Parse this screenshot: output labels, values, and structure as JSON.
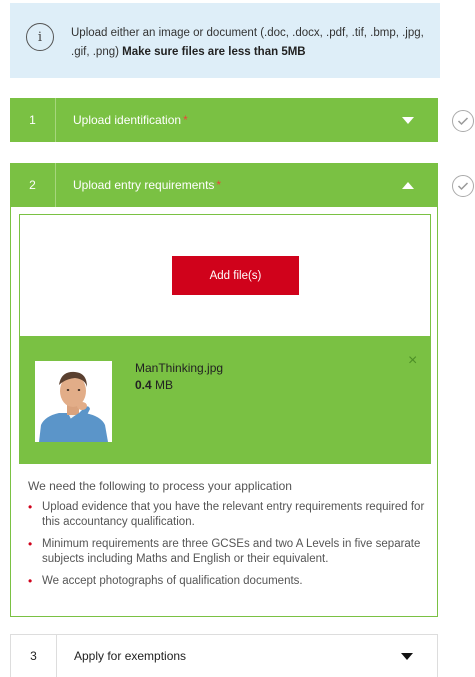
{
  "info": {
    "text": "Upload either an image or document (.doc, .docx, .pdf, .tif, .bmp, .jpg, .gif, .png)",
    "bold_text": "Make sure files are less than 5MB"
  },
  "sections": [
    {
      "number": "1",
      "title": "Upload identification",
      "required": "*",
      "state": "collapsed"
    },
    {
      "number": "2",
      "title": "Upload entry requirements",
      "required": "*",
      "state": "expanded"
    },
    {
      "number": "3",
      "title": "Apply for exemptions",
      "required": "",
      "state": "collapsed"
    }
  ],
  "upload": {
    "add_button_label": "Add file(s)",
    "file": {
      "name": "ManThinking.jpg",
      "size_value": "0.4",
      "size_unit": "MB",
      "remove_label": "×"
    }
  },
  "requirements": {
    "intro": "We need the following to process your application",
    "items": [
      "Upload evidence that you have the relevant entry requirements required for this accountancy qualification.",
      "Minimum requirements are three GCSEs and two A Levels in five separate subjects including Maths and English or their equivalent.",
      "We accept photographs of qualification documents."
    ]
  },
  "colors": {
    "green": "#7ac143",
    "red_button": "#d0021b",
    "info_bg": "#deeef8"
  },
  "icons": {
    "info": "i",
    "section_status": "check-circle-icon"
  }
}
